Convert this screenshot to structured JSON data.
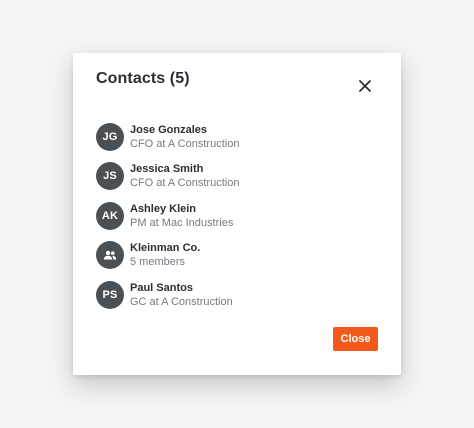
{
  "dialog": {
    "title": "Contacts (5)",
    "close_icon": "close-icon",
    "close_button_label": "Close",
    "accent_color": "#f25a1c",
    "avatar_color": "#4a5156"
  },
  "contacts": [
    {
      "initials": "JG",
      "name": "Jose Gonzales",
      "subtitle": "CFO at A Construction",
      "avatar_type": "initials"
    },
    {
      "initials": "JS",
      "name": "Jessica Smith",
      "subtitle": "CFO at A Construction",
      "avatar_type": "initials"
    },
    {
      "initials": "AK",
      "name": "Ashley Klein",
      "subtitle": "PM at Mac Industries",
      "avatar_type": "initials"
    },
    {
      "initials": "",
      "name": "Kleinman Co.",
      "subtitle": "5 members",
      "avatar_type": "group-icon"
    },
    {
      "initials": "PS",
      "name": "Paul Santos",
      "subtitle": "GC at A Construction",
      "avatar_type": "initials"
    }
  ]
}
